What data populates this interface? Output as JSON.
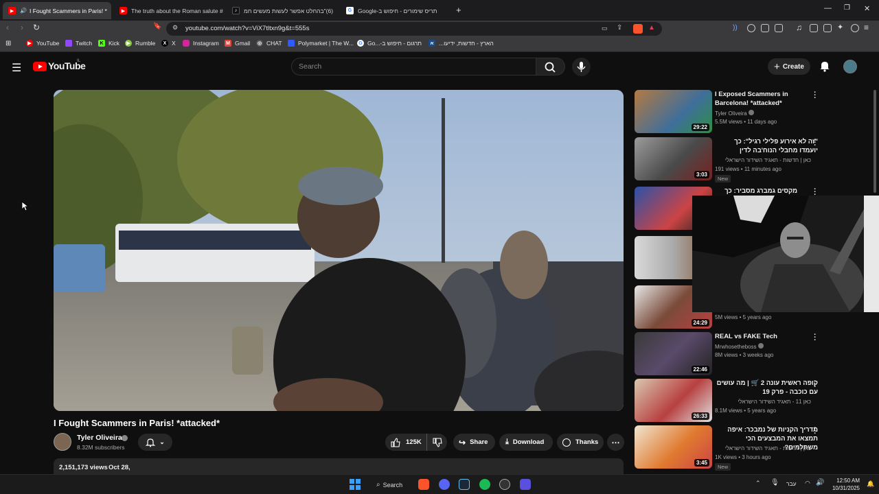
{
  "browser": {
    "tabs": [
      {
        "title": "I Fought Scammers in Paris! *",
        "active": true
      },
      {
        "title": "The truth about the Roman salute #",
        "active": false
      },
      {
        "title": "(6)\"בהחלט אפשר לעשות מעשים חמ",
        "active": false
      },
      {
        "title": "תריס שימורים - חיפוש ב-Google",
        "active": false
      }
    ],
    "new_tab": "+",
    "url": "youtube.com/watch?v=ViX7tltxn9g&t=555s"
  },
  "bookmarks": [
    {
      "label": "YouTube",
      "icon": "youtube-icon"
    },
    {
      "label": "Twitch",
      "icon": "twitch-icon"
    },
    {
      "label": "Kick",
      "icon": "kick-icon"
    },
    {
      "label": "Rumble",
      "icon": "rumble-icon"
    },
    {
      "label": "X",
      "icon": "x-icon"
    },
    {
      "label": "Instagram",
      "icon": "instagram-icon"
    },
    {
      "label": "Gmail",
      "icon": "gmail-icon"
    },
    {
      "label": "CHAT",
      "icon": "chatgpt-icon"
    },
    {
      "label": "Polymarket | The W...",
      "icon": "polymarket-icon"
    },
    {
      "label": "תרגום - חיפוש ב-...Go",
      "icon": "google-icon"
    },
    {
      "label": "הארץ - חדשות, ידיעו...",
      "icon": "haaretz-icon"
    }
  ],
  "youtube": {
    "logo_text": "YouTube",
    "country": "IL",
    "search_placeholder": "Search",
    "create_label": "Create"
  },
  "video": {
    "title": "I Fought Scammers in Paris! *attacked*",
    "channel": "Tyler Oliveira",
    "subscribers": "8.32M subscribers",
    "likes": "125K",
    "share": "Share",
    "download": "Download",
    "thanks": "Thanks",
    "views": "2,151,173 views",
    "date": "Oct 28,"
  },
  "recommendations": [
    {
      "title": "I Exposed Scammers in Barcelona! *attacked*",
      "channel": "Tyler Oliveira",
      "meta": "5.5M views • 11 days ago",
      "duration": "29:22",
      "rtl": false,
      "verified": true
    },
    {
      "title": "\"זה לא אירוע פלילי רגיל\": כך יועמדו מחבלי הנוח'בה לדין",
      "channel": "כאן | חדשות - תאגיד השידור הישראלי",
      "meta": "191 views • 11 minutes ago",
      "duration": "3:03",
      "rtl": true,
      "badge": "New"
    },
    {
      "title": "מקסים גמברג מסביר: כך תמשיע",
      "channel": "",
      "meta": "",
      "duration": "",
      "rtl": true
    },
    {
      "title": "",
      "channel": "",
      "meta": "",
      "duration": "",
      "rtl": false
    },
    {
      "title": "",
      "channel": "",
      "meta": "5M views • 5 years ago",
      "duration": "24:29",
      "rtl": false
    },
    {
      "title": "REAL vs FAKE Tech",
      "channel": "Mrwhosetheboss",
      "meta": "8M views • 3 weeks ago",
      "duration": "22:46",
      "rtl": false,
      "verified": true
    },
    {
      "title": "קופה ראשית עונה 2 🛒 | מה עושים עם כוכבה - פרק 19",
      "channel": "כאן 11 - תאגיד השידור הישראלי",
      "meta": "8.1M views • 5 years ago",
      "duration": "26:33",
      "rtl": true
    },
    {
      "title": "מדריך הקניות של נמבכר: איפה תמצאו את המבצעים הכי משתלמים?",
      "channel": "כאן | חדשות - תאגיד השידור הישראלי",
      "meta": "1K views • 3 hours ago",
      "duration": "3:45",
      "rtl": true,
      "badge": "New"
    }
  ],
  "taskbar": {
    "search_label": "Search",
    "language": "עבר",
    "time": "12:50 AM",
    "date": "10/31/2025"
  }
}
